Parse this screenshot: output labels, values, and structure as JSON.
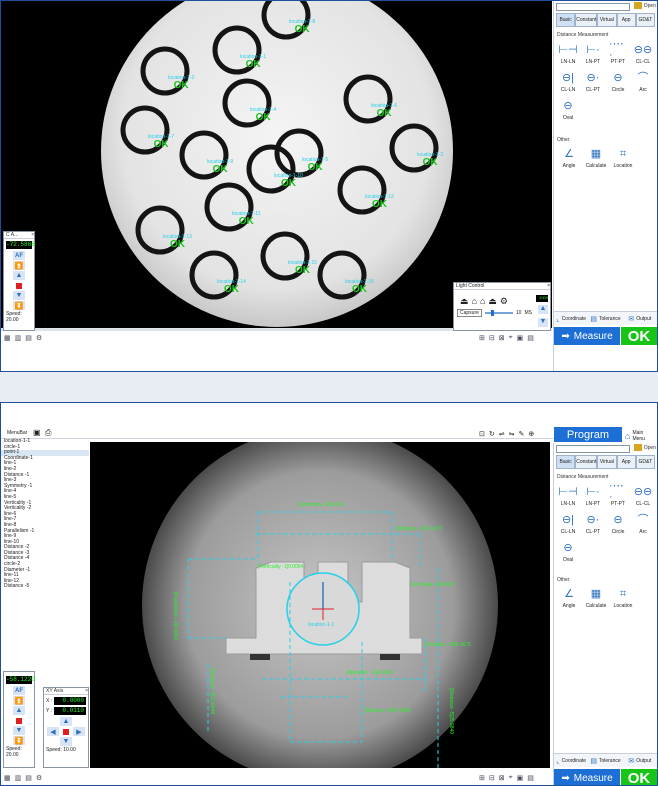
{
  "top": {
    "open_label": "Open",
    "tabs": [
      "Basic",
      "Constant",
      "Virtual",
      "App",
      "GD&T"
    ],
    "distance_section": "Distance Measurement",
    "tools": [
      "LN-LN",
      "LN-PT",
      "PT-PT",
      "CL-CL",
      "CL-LN",
      "CL-PT",
      "Circle",
      "Arc",
      "Oval"
    ],
    "other_section": "Other",
    "other_tools": [
      "Angle",
      "Calculate",
      "Location"
    ],
    "bottom_buttons": [
      "Coordinate",
      "Tolerance",
      "Output"
    ],
    "measure_label": "Measure",
    "ok_label": "OK",
    "dro": {
      "title": "C A...",
      "value": "-72.5868",
      "af": "AF",
      "speed": "Speed: 20.00"
    },
    "light": {
      "title": "Light Control",
      "value": "1000",
      "mode": "Capsure",
      "num": "10",
      "unit": "MS"
    },
    "labels": [
      {
        "id": "location-1-1",
        "text": "location-1-1"
      },
      {
        "id": "location-1-2",
        "text": "location-1-2"
      },
      {
        "id": "location-1-3",
        "text": "location-1-3"
      },
      {
        "id": "location-1-4",
        "text": "location-1-4"
      },
      {
        "id": "location-1-5",
        "text": "location-1-5"
      },
      {
        "id": "location-1-6",
        "text": "location-1-6"
      },
      {
        "id": "location-1-7",
        "text": "location-1-7"
      },
      {
        "id": "location-1-8",
        "text": "location-1-8"
      },
      {
        "id": "location-1-9",
        "text": "location-1-9"
      },
      {
        "id": "location-1-10",
        "text": "location-1-10"
      },
      {
        "id": "location-1-11",
        "text": "location-1-11"
      },
      {
        "id": "location-1-12",
        "text": "location-1-12"
      },
      {
        "id": "location-1-13",
        "text": "location-1-13"
      },
      {
        "id": "location-1-14",
        "text": "location-1-14"
      },
      {
        "id": "location-1-15",
        "text": "location-1-15"
      },
      {
        "id": "location-1-16",
        "text": "location-1-16"
      }
    ],
    "ok_text": "OK"
  },
  "bottom": {
    "menu_label": "MenuBar",
    "program_label": "Program",
    "main_menu": "Main Menu",
    "open_label": "Open",
    "tabs": [
      "Basic",
      "Constant",
      "Virtual",
      "App",
      "GD&T"
    ],
    "distance_section": "Distance Measurement",
    "tools": [
      "LN-LN",
      "LN-PT",
      "PT-PT",
      "CL-CL",
      "CL-LN",
      "CL-PT",
      "Circle",
      "Arc",
      "Oval"
    ],
    "other_section": "Other",
    "other_tools": [
      "Angle",
      "Calculate",
      "Location"
    ],
    "bottom_buttons": [
      "Coordinate",
      "Tolerance",
      "Output"
    ],
    "measure_label": "Measure",
    "ok_label": "OK",
    "features": [
      "location-1-1",
      "circle-1",
      "point-1",
      "Coordinate-1",
      "line-1",
      "line-2",
      "Distance -1",
      "line-3",
      "Symmetry -1",
      "line-4",
      "line-5",
      "Verticality -1",
      "Verticality -2",
      "line-6",
      "line-7",
      "line-8",
      "Parallelism -1",
      "line-9",
      "line-10",
      "Distance -2",
      "Distance -3",
      "Distance -4",
      "circle-2",
      "Diameter -1",
      "line-11",
      "line-12",
      "Distance -5"
    ],
    "dro1": {
      "value": "-58.1220",
      "af": "AF",
      "speed": "Speed: 20.00"
    },
    "dro2": {
      "title": "XY Axis",
      "x_label": "X :",
      "x_value": "0.0000",
      "y_label": "Y :",
      "y_value": "0.0110",
      "speed": "Speed: 10.00"
    },
    "measurements": {
      "symmetry": "[Symmetry -1]0.0324",
      "distance1": "[Distance -1]41.9170",
      "parallelism": "[Parallelism -1]0.0202",
      "verticality1": "[Verticality -1]0.0004",
      "verticality2": "[Verticality -2]0.0087",
      "location": "location-1-1",
      "distance2": "[Distance -2]66.1671",
      "diameter": "[Diameter -1]14.0209",
      "distance3": "[Distance -3]10.0646",
      "distance4": "[Distance -4]19.1658",
      "distance5": "[Distance -5]25.9840"
    }
  },
  "colors": {
    "accent": "#1d6fd6",
    "ok": "#18c418",
    "cyan": "#25d0e8",
    "green": "#2bf02b"
  }
}
